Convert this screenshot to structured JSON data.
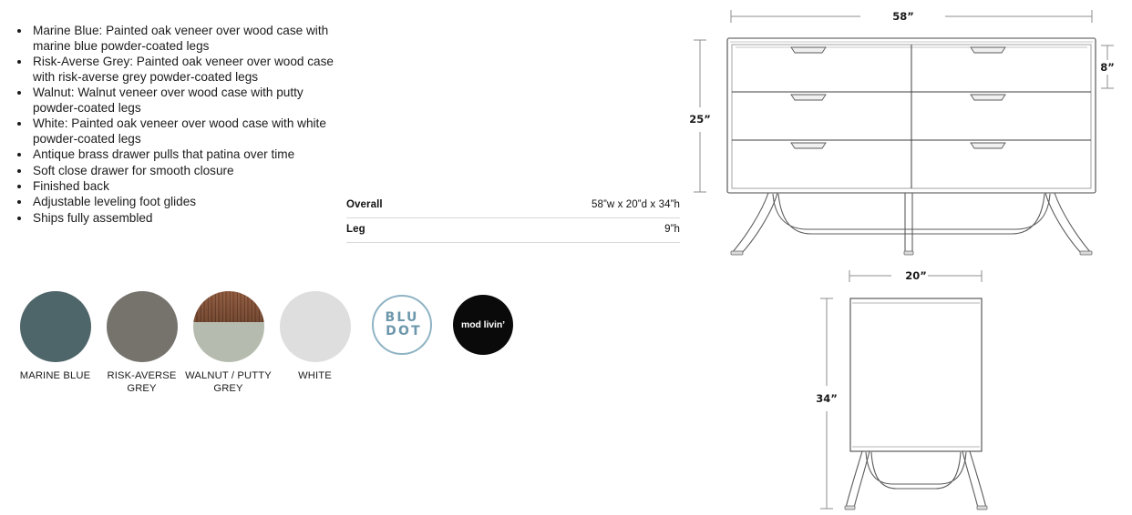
{
  "features": {
    "items": [
      "Marine Blue: Painted oak veneer over wood case with marine blue powder-coated legs",
      "Risk-Averse Grey: Painted oak veneer over wood case with risk-averse grey powder-coated legs",
      "Walnut: Walnut veneer over wood case with putty powder-coated legs",
      "White: Painted oak veneer over wood case with white powder-coated legs",
      "Antique brass drawer pulls that patina over time",
      "Soft close drawer for smooth closure",
      "Finished back",
      "Adjustable leveling foot glides",
      "Ships fully assembled"
    ]
  },
  "dimensions_table": {
    "rows": [
      {
        "label": "Overall",
        "value": "58”w x 20”d x 34”h"
      },
      {
        "label": "Leg",
        "value": "9”h"
      }
    ]
  },
  "swatches": [
    {
      "label": "MARINE BLUE",
      "color": "#4e6569"
    },
    {
      "label": "RISK-AVERSE GREY",
      "color": "#76736d"
    },
    {
      "label": "WALNUT / PUTTY GREY",
      "color": "#7a4930",
      "color_secondary": "#b5bcaf"
    },
    {
      "label": "WHITE",
      "color": "#dedede"
    }
  ],
  "logos": {
    "bludot": {
      "line1": "BLU",
      "line2": "DOT",
      "color": "#8fb4c4"
    },
    "modlivin": {
      "text": "mod livin’",
      "color": "#0a0a0a"
    }
  },
  "drawings": {
    "front_view": {
      "width_label": "58”",
      "height_label": "25”",
      "drawer_height_label": "8”",
      "drawer_columns": 2,
      "drawer_rows": 3
    },
    "side_view": {
      "depth_label": "20”",
      "height_label": "34”"
    }
  }
}
